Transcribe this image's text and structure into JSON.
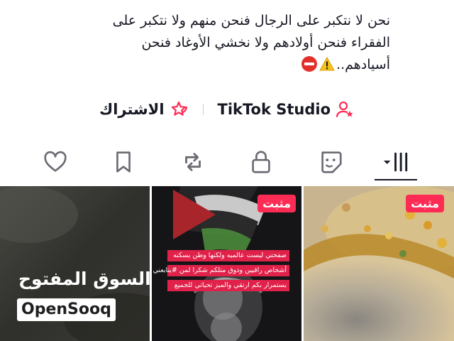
{
  "profile": {
    "bio_lines": [
      "نحن لا نتكبر على الرجال فنحن منهم ولا نتكبر على",
      "الفقراء فنحن أولادهم ولا نخشي الأوغاد فنحن",
      "أسيادهم.."
    ],
    "bio_emoji": [
      "warning-emoji",
      "no-entry-emoji"
    ]
  },
  "links": {
    "tiktok_studio": "TikTok Studio",
    "subscribe": "الاشتراك"
  },
  "tabs": [
    {
      "icon": "grid-icon",
      "active": true
    },
    {
      "icon": "sticker-icon",
      "active": false
    },
    {
      "icon": "lock-icon",
      "active": false
    },
    {
      "icon": "repost-icon",
      "active": false
    },
    {
      "icon": "bookmark-icon",
      "active": false
    },
    {
      "icon": "heart-icon",
      "active": false
    }
  ],
  "videos": [
    {
      "pinned_label": "مثبت",
      "thumbnail": "food-closeup"
    },
    {
      "pinned_label": "مثبت",
      "thumbnail": "flag-and-portrait",
      "caption_lines": [
        "صفحتي ليست عالميه ولكنها وطن يسكنه",
        "أشخاص راقيين وذوق متلكم شكرا لمن #يتابعني",
        "بستمرار بكم ارتقي والميز تحياتي للجميع"
      ]
    },
    {
      "pinned_label": null,
      "thumbnail": "opensooq-logo",
      "brand_arabic": "السوق المفتوح",
      "brand_latin": "OpenSooq"
    }
  ],
  "colors": {
    "accent": "#fe2c55",
    "text": "#161823",
    "divider": "#d0d0d4"
  }
}
